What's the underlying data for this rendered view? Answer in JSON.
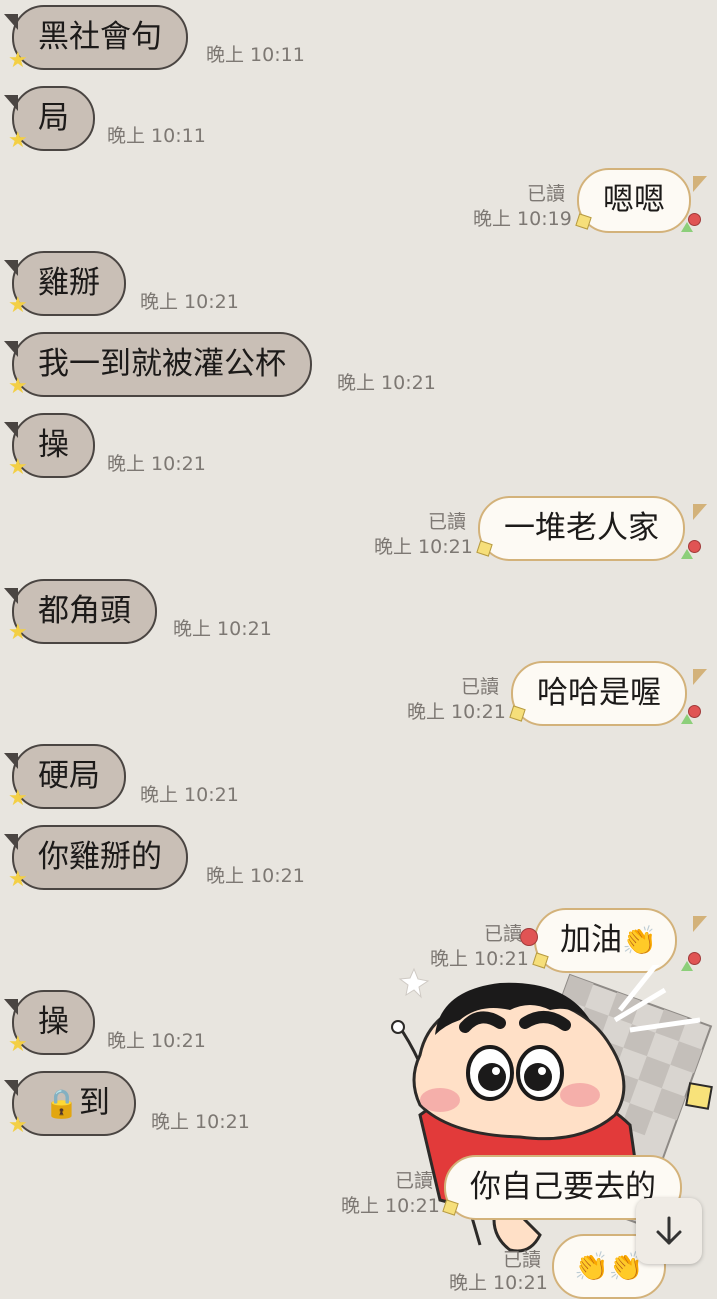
{
  "messages": [
    {
      "side": "in",
      "text": "黑社會句",
      "time": "晚上 10:11"
    },
    {
      "side": "in",
      "text": "局",
      "time": "晚上 10:11"
    },
    {
      "side": "out",
      "text": "嗯嗯",
      "time": "晚上 10:19",
      "read": "已讀"
    },
    {
      "side": "in",
      "text": "雞掰",
      "time": "晚上 10:21"
    },
    {
      "side": "in",
      "text": "我一到就被灌公杯",
      "time": "晚上 10:21"
    },
    {
      "side": "in",
      "text": "操",
      "time": "晚上 10:21"
    },
    {
      "side": "out",
      "text": "一堆老人家",
      "time": "晚上 10:21",
      "read": "已讀"
    },
    {
      "side": "in",
      "text": "都角頭",
      "time": "晚上 10:21"
    },
    {
      "side": "out",
      "text": "哈哈是喔",
      "time": "晚上 10:21",
      "read": "已讀"
    },
    {
      "side": "in",
      "text": "硬局",
      "time": "晚上 10:21"
    },
    {
      "side": "in",
      "text": "你雞掰的",
      "time": "晚上 10:21"
    },
    {
      "side": "out",
      "text": "加油",
      "emoji": "👏",
      "time": "晚上 10:21",
      "read": "已讀"
    },
    {
      "side": "in",
      "text": "操",
      "time": "晚上 10:21"
    },
    {
      "side": "in",
      "text": "到",
      "emoji_prefix": "🔒",
      "time": "晚上 10:21"
    },
    {
      "side": "out",
      "text": "你自己要去的",
      "time": "晚上 10:21",
      "read": "已讀"
    },
    {
      "side": "out",
      "text": "",
      "emoji": "👏👏",
      "time": "晚上 10:21",
      "read": "已讀"
    }
  ],
  "sticker": {
    "name": "crayon-shinchan-sticker"
  },
  "scroll_button": {
    "icon": "arrow-down-icon"
  },
  "colors": {
    "background": "#e8e5df",
    "incoming_bubble": "#c9bfb6",
    "outgoing_bubble": "#fdfaf4",
    "outgoing_border": "#d3b27a",
    "timestamp": "#7d7873"
  }
}
